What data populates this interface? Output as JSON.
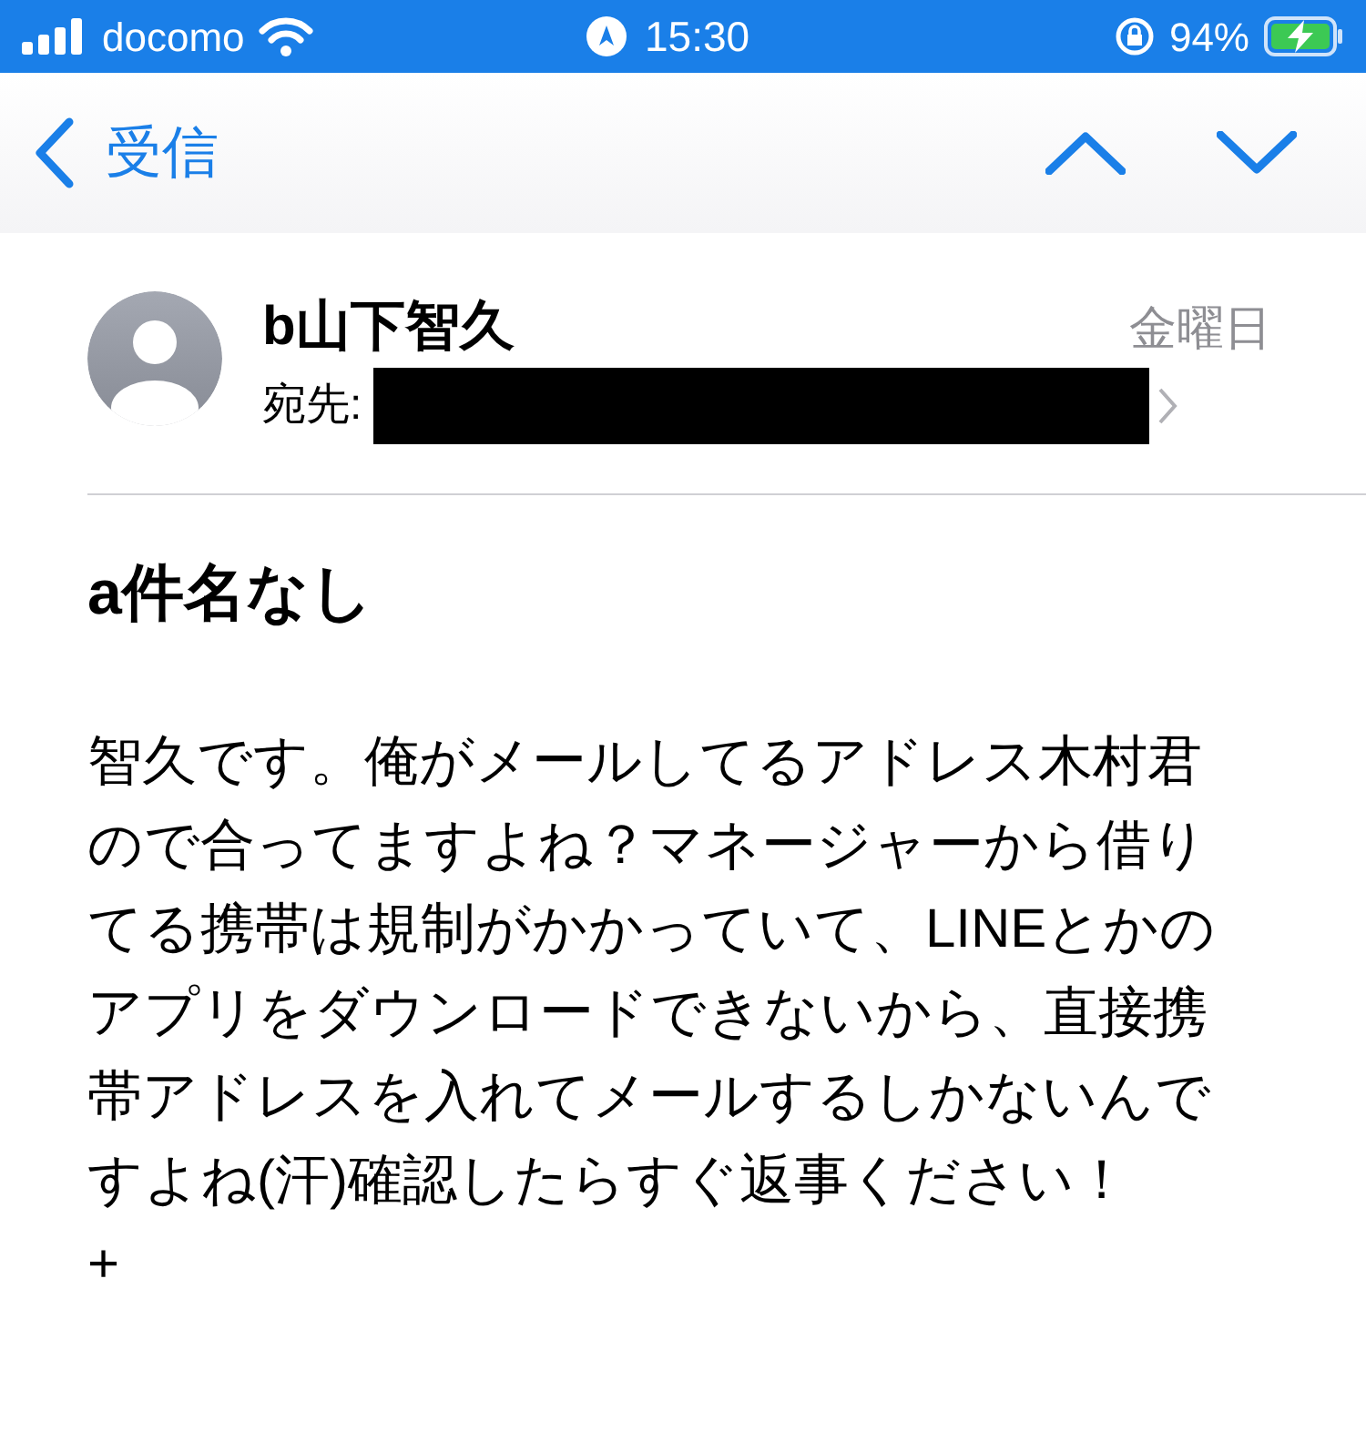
{
  "status_bar": {
    "carrier": "docomo",
    "time": "15:30",
    "battery": "94%"
  },
  "nav": {
    "back_label": "受信"
  },
  "message": {
    "sender": "b山下智久",
    "date": "金曜日",
    "to_label": "宛先:",
    "to_redacted": true,
    "subject": "a件名なし",
    "body_lines": [
      "智久です。俺がメールしてるアドレス木村君",
      "ので合ってますよね？マネージャーから借り",
      "てる携帯は規制がかかっていて、LINEとかの",
      "アプリをダウンロードできないから、直接携",
      "帯アドレスを入れてメールするしかないんで",
      "すよね(汗)確認したらすぐ返事ください！",
      "+"
    ]
  }
}
